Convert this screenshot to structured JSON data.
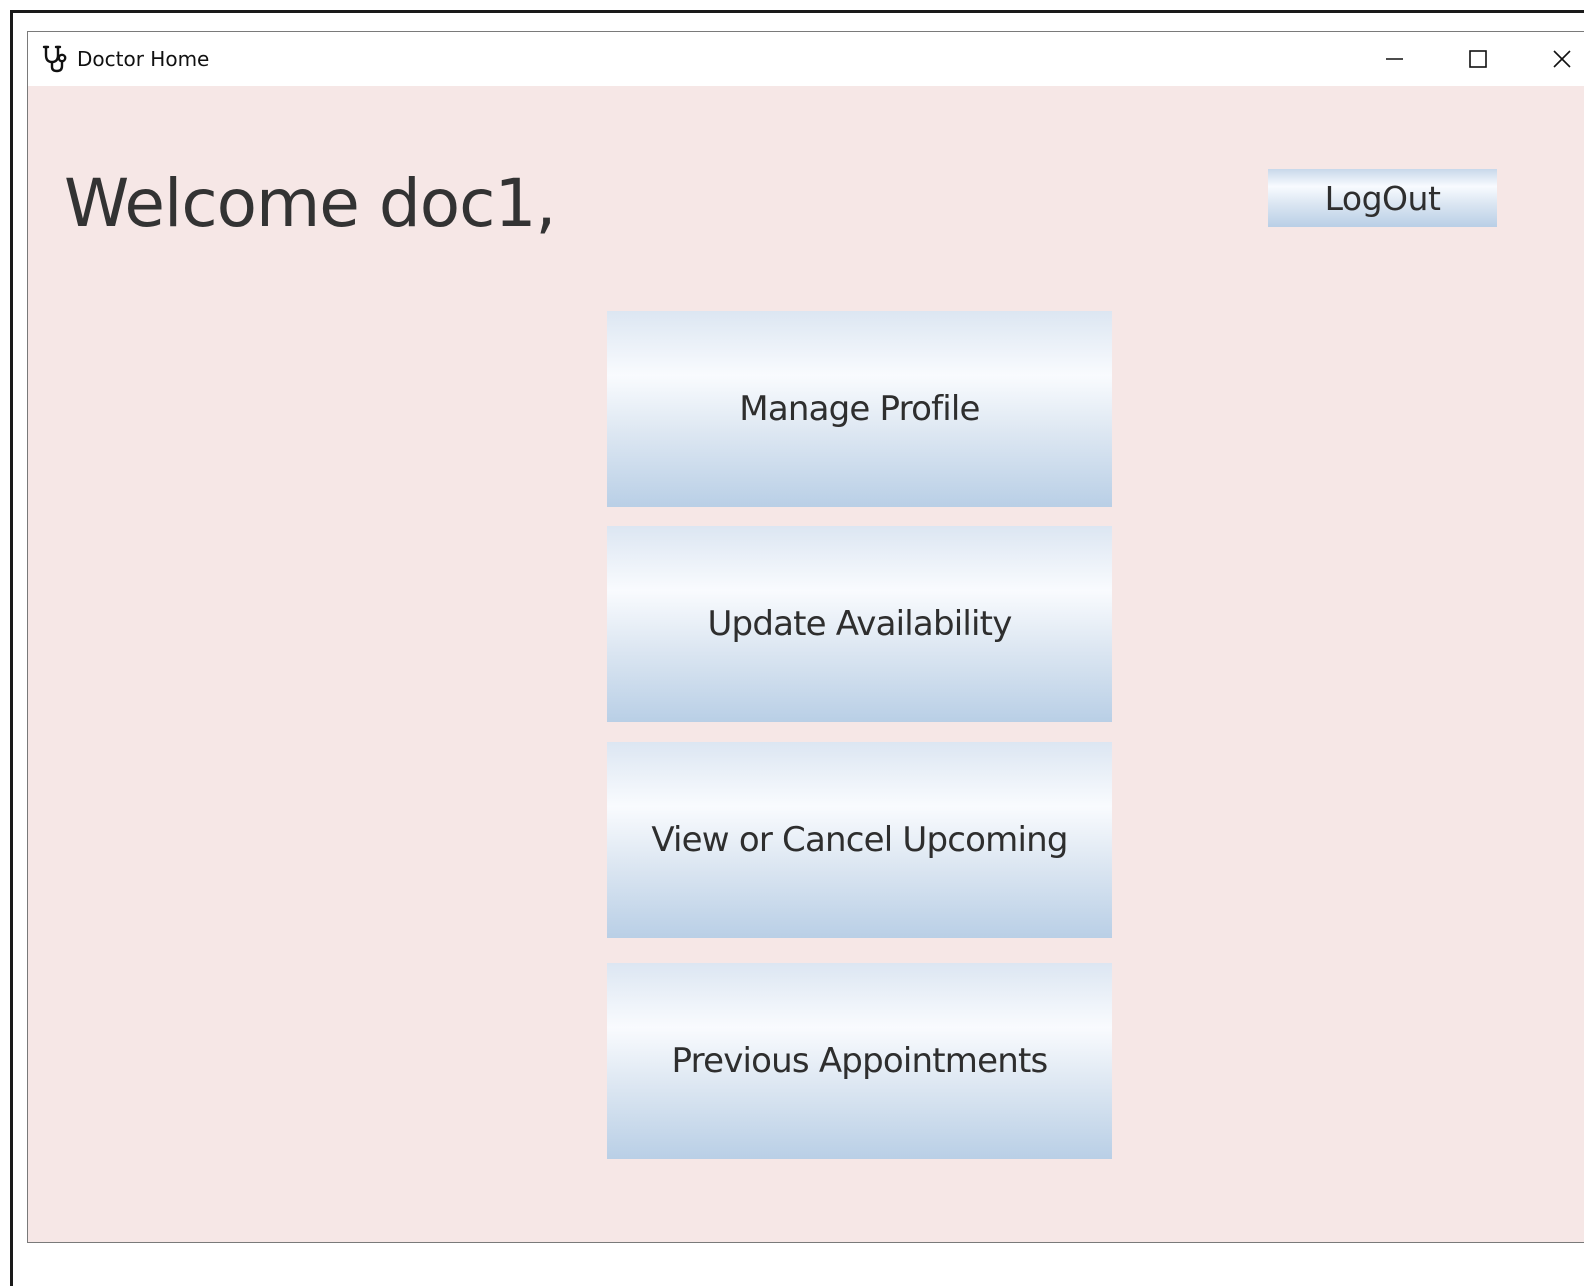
{
  "window": {
    "title": "Doctor Home",
    "icon": "stethoscope-icon",
    "controls": {
      "minimize": "minimize-icon",
      "maximize": "maximize-icon",
      "close": "close-icon"
    }
  },
  "main": {
    "welcome": "Welcome doc1,",
    "logout_label": "LogOut",
    "buttons": [
      {
        "label": "Manage Profile"
      },
      {
        "label": "Update Availability"
      },
      {
        "label": "View or Cancel Upcoming"
      },
      {
        "label": "Previous Appointments"
      }
    ]
  },
  "colors": {
    "window_background": "#f6e7e6",
    "titlebar": "#ffffff",
    "button_gradient_top": "#f9fbfe",
    "button_gradient_bottom": "#b9cfe6",
    "text": "#333333"
  }
}
